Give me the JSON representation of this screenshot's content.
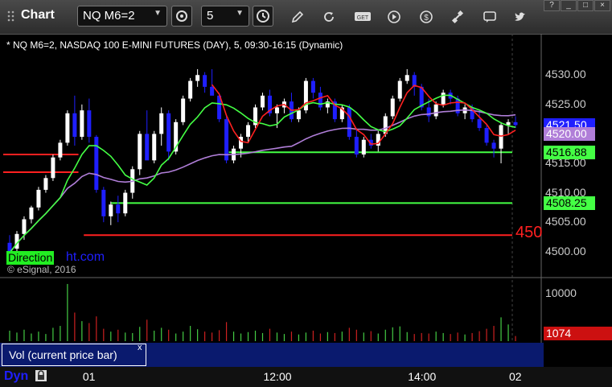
{
  "titlebar": {
    "title": "Chart",
    "symbol": "NQ M6=2",
    "interval": "5"
  },
  "info_line": "* NQ M6=2, NASDAQ 100 E-MINI FUTURES (DAY), 5, 09:30-16:15 (Dynamic)",
  "watermark": "© eSignal, 2016",
  "direction_label": "Direction",
  "direction_suffix": "ht.com",
  "red_level_label": "450",
  "vol_label": "Vol (current price bar)",
  "close_x": "x",
  "dyn_label": "Dyn",
  "colors": {
    "bull": "#ffffff",
    "bear": "#1f1fff",
    "ma_red": "#ff2020",
    "ma_green": "#44ff44",
    "ma_purple": "#b07ed8",
    "hline_red": "#ff2020",
    "hline_green": "#44ff44",
    "vol_bar": "#cc2020"
  },
  "chart_data": {
    "type": "candlestick",
    "ylim": [
      4496,
      4534
    ],
    "price_ticks": [
      "4530.00",
      "4525.00",
      "4520.00",
      "4515.00",
      "4510.00",
      "4505.00",
      "4500.00"
    ],
    "tags": [
      {
        "text": "4521.50",
        "value": 4521.5,
        "bg": "#1f1fff",
        "fg": "#ffffff"
      },
      {
        "text": "4520.00",
        "value": 4520.0,
        "bg": "#b07ed8",
        "fg": "#ffffff"
      },
      {
        "text": "4516.88",
        "value": 4516.88,
        "bg": "#44ff44",
        "fg": "#000000"
      },
      {
        "text": "4508.25",
        "value": 4508.25,
        "bg": "#44ff44",
        "fg": "#000000"
      }
    ],
    "hlines": [
      {
        "value": 4516.88,
        "color": "green",
        "from": 0.42
      },
      {
        "value": 4508.25,
        "color": "green",
        "from": 0.2
      },
      {
        "value": 4502.8,
        "color": "red",
        "from": 0.15
      },
      {
        "value": 4516.5,
        "color": "red_short",
        "from": 0.0,
        "to": 0.14
      },
      {
        "value": 4513.5,
        "color": "red_short",
        "from": 0.0,
        "to": 0.14
      }
    ],
    "candles": [
      [
        4501.5,
        4502.8,
        4499.5,
        4499.8
      ],
      [
        4500.5,
        4503.5,
        4500,
        4503
      ],
      [
        4503,
        4506,
        4502,
        4505.5
      ],
      [
        4505.5,
        4507.8,
        4504.8,
        4507.5
      ],
      [
        4507.5,
        4511,
        4507,
        4510.5
      ],
      [
        4510.5,
        4513,
        4510,
        4512.5
      ],
      [
        4512.5,
        4516.5,
        4512,
        4516
      ],
      [
        4516,
        4519,
        4515.5,
        4518.5
      ],
      [
        4518.5,
        4524,
        4518,
        4523.5
      ],
      [
        4523.5,
        4526.5,
        4518,
        4519.5
      ],
      [
        4519.5,
        4525,
        4519,
        4524
      ],
      [
        4524,
        4526,
        4518.5,
        4519.5
      ],
      [
        4519.5,
        4519.8,
        4510,
        4510.5
      ],
      [
        4510.5,
        4511,
        4505,
        4506
      ],
      [
        4506,
        4508.5,
        4504.5,
        4508
      ],
      [
        4508,
        4509.5,
        4505,
        4506.5
      ],
      [
        4506.5,
        4510.5,
        4506,
        4510
      ],
      [
        4510,
        4514.5,
        4509,
        4514
      ],
      [
        4514,
        4520.5,
        4513,
        4520
      ],
      [
        4520,
        4524,
        4518,
        4515.5
      ],
      [
        4515.5,
        4520.5,
        4515,
        4520
      ],
      [
        4520,
        4524.5,
        4518,
        4523.5
      ],
      [
        4523.5,
        4524,
        4515.5,
        4517
      ],
      [
        4517,
        4522.5,
        4516.5,
        4522
      ],
      [
        4522,
        4526.5,
        4521.5,
        4526
      ],
      [
        4526,
        4529.5,
        4525.5,
        4529
      ],
      [
        4529,
        4531,
        4528,
        4530
      ],
      [
        4530,
        4530.5,
        4527,
        4528
      ],
      [
        4528,
        4531,
        4527.5,
        4526.5
      ],
      [
        4526.5,
        4527,
        4522,
        4522.5
      ],
      [
        4522.5,
        4523,
        4515,
        4515.5
      ],
      [
        4515.5,
        4518,
        4515,
        4517.5
      ],
      [
        4517.5,
        4520,
        4516,
        4519.5
      ],
      [
        4519.5,
        4522,
        4518.5,
        4521.5
      ],
      [
        4521.5,
        4525,
        4521,
        4524.5
      ],
      [
        4524.5,
        4527,
        4524,
        4526.5
      ],
      [
        4526.5,
        4527.5,
        4523,
        4523.5
      ],
      [
        4523.5,
        4525,
        4521,
        4524.5
      ],
      [
        4524.5,
        4526,
        4523.5,
        4525.5
      ],
      [
        4525.5,
        4527,
        4522,
        4522.5
      ],
      [
        4522.5,
        4524.5,
        4522,
        4524
      ],
      [
        4524,
        4529.5,
        4523.5,
        4529
      ],
      [
        4529,
        4529.5,
        4526,
        4527
      ],
      [
        4527,
        4528,
        4524,
        4524.5
      ],
      [
        4524.5,
        4526,
        4523.5,
        4525.5
      ],
      [
        4525.5,
        4526,
        4522,
        4522.5
      ],
      [
        4522.5,
        4525,
        4522,
        4524.5
      ],
      [
        4524.5,
        4525,
        4519,
        4519.5
      ],
      [
        4519.5,
        4521,
        4516,
        4516.5
      ],
      [
        4516.5,
        4519.5,
        4516,
        4519
      ],
      [
        4519,
        4520,
        4517.5,
        4518
      ],
      [
        4518,
        4520.5,
        4517,
        4520
      ],
      [
        4520,
        4523.5,
        4519.5,
        4523
      ],
      [
        4523,
        4526.5,
        4522.5,
        4526
      ],
      [
        4526,
        4529.5,
        4525.5,
        4529
      ],
      [
        4529,
        4531,
        4528.5,
        4530
      ],
      [
        4530,
        4530.5,
        4526.5,
        4528
      ],
      [
        4528,
        4528.5,
        4524,
        4524.5
      ],
      [
        4524.5,
        4526,
        4522,
        4523
      ],
      [
        4523,
        4525.5,
        4522.5,
        4525
      ],
      [
        4525,
        4527.5,
        4524.5,
        4527
      ],
      [
        4527,
        4527.5,
        4525,
        4526
      ],
      [
        4526,
        4526.5,
        4523,
        4523.5
      ],
      [
        4523.5,
        4525,
        4522.5,
        4524.5
      ],
      [
        4524.5,
        4525,
        4522,
        4522.5
      ],
      [
        4522.5,
        4524,
        4520.5,
        4521
      ],
      [
        4521,
        4521.5,
        4518,
        4518.5
      ],
      [
        4518.5,
        4519,
        4516,
        4517.5
      ],
      [
        4517.5,
        4522,
        4515,
        4521.5
      ],
      [
        4521.5,
        4522.5,
        4520,
        4522
      ],
      [
        4522,
        4523,
        4521,
        4521.5
      ]
    ],
    "volume": {
      "ymax": 12500,
      "ticks": [
        "10000"
      ],
      "last_text": "1074",
      "last_value": 1074,
      "bars": [
        2200,
        1800,
        2400,
        1600,
        2000,
        1500,
        2800,
        3200,
        12000,
        6000,
        4200,
        3800,
        5200,
        2600,
        2000,
        2400,
        1800,
        1700,
        3000,
        4500,
        2200,
        2800,
        2400,
        1600,
        2000,
        3200,
        2500,
        2000,
        1800,
        2300,
        4000,
        2000,
        1600,
        1900,
        2200,
        1700,
        2600,
        1800,
        1500,
        2000,
        1400,
        1800,
        2200,
        1600,
        1900,
        1700,
        2000,
        2800,
        2400,
        1800,
        2100,
        1600,
        2400,
        2900,
        3100,
        1900,
        1500,
        1700,
        1600,
        2000,
        1700,
        1500,
        1800,
        1400,
        1700,
        2100,
        2600,
        3200,
        5000,
        3500,
        1074
      ]
    },
    "x_ticks": [
      {
        "label": "01",
        "index": 11
      },
      {
        "label": "12:00",
        "index": 36
      },
      {
        "label": "14:00",
        "index": 56
      },
      {
        "label": "02",
        "index": 70
      }
    ]
  }
}
